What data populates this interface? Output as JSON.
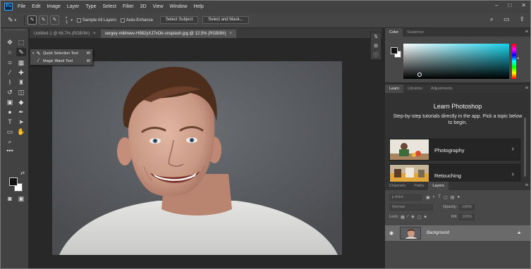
{
  "app": {
    "logo": "Ps",
    "menu": [
      "File",
      "Edit",
      "Image",
      "Layer",
      "Type",
      "Select",
      "Filter",
      "3D",
      "View",
      "Window",
      "Help"
    ],
    "window_controls": [
      "–",
      "□",
      "✕"
    ]
  },
  "options_bar": {
    "tool_icon": "quick-selection-brush",
    "brush_size": "1",
    "sample_all_layers": "Sample All Layers",
    "auto_enhance": "Auto-Enhance",
    "select_subject": "Select Subject",
    "select_and_mask": "Select and Mask...",
    "icons": [
      "search-icon",
      "workspace-icon",
      "share-icon"
    ]
  },
  "tool_flyout": {
    "items": [
      {
        "label": "Quick Selection Tool",
        "shortcut": "W",
        "selected": true
      },
      {
        "label": "Magic Wand Tool",
        "shortcut": "W",
        "selected": false
      }
    ]
  },
  "documents": {
    "tabs": [
      {
        "label": "Untitled-1 @ 66.7% (RGB/8#)",
        "close": "×",
        "active": false
      },
      {
        "label": "sergey-mikheev-H982yXJ7vOk-unsplash.jpg @ 12.5% (RGB/8#)",
        "close": "×",
        "active": true
      }
    ]
  },
  "color_panel": {
    "tabs": [
      "Color",
      "Swatches"
    ],
    "accent_hex": "#17d1ec"
  },
  "learn_panel": {
    "tabs": [
      "Learn",
      "Libraries",
      "Adjustments"
    ],
    "title": "Learn Photoshop",
    "description": "Step-by-step tutorials directly in the app. Pick a topic below to begin.",
    "cards": [
      {
        "title": "Photography",
        "chevron": "›"
      },
      {
        "title": "Retouching",
        "chevron": "›"
      }
    ]
  },
  "layers_panel": {
    "tabs": [
      "Channels",
      "Paths",
      "Layers"
    ],
    "kind_filter": "ρ Kind",
    "blend_mode": "Normal",
    "opacity_label": "Opacity:",
    "opacity_value": "100%",
    "lock_label": "Lock:",
    "fill_label": "Fill:",
    "fill_value": "100%",
    "layers": [
      {
        "name": "Background",
        "visible": true,
        "locked": true
      }
    ]
  }
}
